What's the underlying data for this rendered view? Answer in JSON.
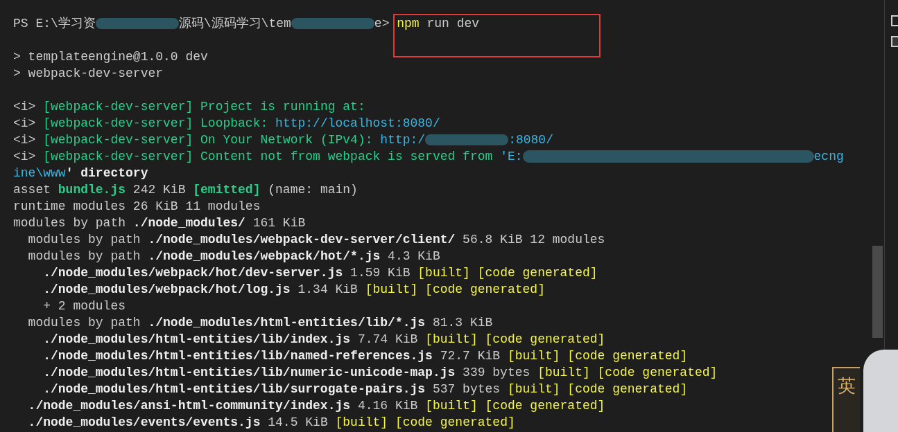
{
  "terminal": {
    "lines": [
      {
        "kind": "text",
        "segments": [
          {
            "kind": "plain",
            "text": "PS E:\\学习资"
          },
          {
            "kind": "redacted"
          },
          {
            "kind": "plain",
            "text": "源码\\源码学习\\tem"
          },
          {
            "kind": "redacted"
          },
          {
            "kind": "plain",
            "text": "e> "
          },
          {
            "kind": "yellow",
            "text": "npm"
          },
          {
            "kind": "plain",
            "text": " run dev"
          }
        ]
      },
      {
        "kind": "blank"
      },
      {
        "kind": "text",
        "segments": [
          {
            "kind": "plain",
            "text": "> templateengine@1.0.0 dev"
          }
        ]
      },
      {
        "kind": "text",
        "segments": [
          {
            "kind": "plain",
            "text": "> webpack-dev-server"
          }
        ]
      },
      {
        "kind": "blank"
      },
      {
        "kind": "text",
        "segments": [
          {
            "kind": "plain",
            "text": "<i> "
          },
          {
            "kind": "green",
            "text": "[webpack-dev-server] Project is running at:"
          }
        ]
      },
      {
        "kind": "text",
        "segments": [
          {
            "kind": "plain",
            "text": "<i> "
          },
          {
            "kind": "green",
            "text": "[webpack-dev-server] Loopback: "
          },
          {
            "kind": "cyan",
            "text": "http://localhost:8080/"
          }
        ]
      },
      {
        "kind": "text",
        "segments": [
          {
            "kind": "plain",
            "text": "<i> "
          },
          {
            "kind": "green",
            "text": "[webpack-dev-server] On Your Network (IPv4): "
          },
          {
            "kind": "cyan",
            "text": "http:/"
          },
          {
            "kind": "redacted"
          },
          {
            "kind": "cyan",
            "text": ":8080/"
          }
        ]
      },
      {
        "kind": "text",
        "segments": [
          {
            "kind": "plain",
            "text": "<i> "
          },
          {
            "kind": "green",
            "text": "[webpack-dev-server] Content not from webpack is served from "
          },
          {
            "kind": "cyan",
            "text": "'E:"
          },
          {
            "kind": "redacted-long"
          },
          {
            "kind": "cyan",
            "text": "ecng"
          }
        ]
      },
      {
        "kind": "text",
        "segments": [
          {
            "kind": "cyan",
            "text": "ine\\www"
          },
          {
            "kind": "bold",
            "text": "' directory"
          }
        ]
      },
      {
        "kind": "text",
        "segments": [
          {
            "kind": "plain",
            "text": "asset "
          },
          {
            "kind": "green-bold",
            "text": "bundle.js"
          },
          {
            "kind": "plain",
            "text": " 242 KiB "
          },
          {
            "kind": "green-bold",
            "text": "[emitted]"
          },
          {
            "kind": "plain",
            "text": " (name: main)"
          }
        ]
      },
      {
        "kind": "text",
        "segments": [
          {
            "kind": "plain",
            "text": "runtime modules 26 KiB 11 modules"
          }
        ]
      },
      {
        "kind": "text",
        "segments": [
          {
            "kind": "plain",
            "text": "modules by path "
          },
          {
            "kind": "bold",
            "text": "./node_modules/"
          },
          {
            "kind": "plain",
            "text": " 161 KiB"
          }
        ]
      },
      {
        "kind": "text",
        "segments": [
          {
            "kind": "plain",
            "text": "  modules by path "
          },
          {
            "kind": "bold",
            "text": "./node_modules/webpack-dev-server/client/"
          },
          {
            "kind": "plain",
            "text": " 56.8 KiB 12 modules"
          }
        ]
      },
      {
        "kind": "text",
        "segments": [
          {
            "kind": "plain",
            "text": "  modules by path "
          },
          {
            "kind": "bold",
            "text": "./node_modules/webpack/hot/*.js"
          },
          {
            "kind": "plain",
            "text": " 4.3 KiB"
          }
        ]
      },
      {
        "kind": "text",
        "segments": [
          {
            "kind": "bold",
            "text": "    ./node_modules/webpack/hot/dev-server.js"
          },
          {
            "kind": "plain",
            "text": " 1.59 KiB "
          },
          {
            "kind": "yellow",
            "text": "[built] [code generated]"
          }
        ]
      },
      {
        "kind": "text",
        "segments": [
          {
            "kind": "bold",
            "text": "    ./node_modules/webpack/hot/log.js"
          },
          {
            "kind": "plain",
            "text": " 1.34 KiB "
          },
          {
            "kind": "yellow",
            "text": "[built] [code generated]"
          }
        ]
      },
      {
        "kind": "text",
        "segments": [
          {
            "kind": "plain",
            "text": "    + 2 modules"
          }
        ]
      },
      {
        "kind": "text",
        "segments": [
          {
            "kind": "plain",
            "text": "  modules by path "
          },
          {
            "kind": "bold",
            "text": "./node_modules/html-entities/lib/*.js"
          },
          {
            "kind": "plain",
            "text": " 81.3 KiB"
          }
        ]
      },
      {
        "kind": "text",
        "segments": [
          {
            "kind": "bold",
            "text": "    ./node_modules/html-entities/lib/index.js"
          },
          {
            "kind": "plain",
            "text": " 7.74 KiB "
          },
          {
            "kind": "yellow",
            "text": "[built] [code generated]"
          }
        ]
      },
      {
        "kind": "text",
        "segments": [
          {
            "kind": "bold",
            "text": "    ./node_modules/html-entities/lib/named-references.js"
          },
          {
            "kind": "plain",
            "text": " 72.7 KiB "
          },
          {
            "kind": "yellow",
            "text": "[built] [code generated]"
          }
        ]
      },
      {
        "kind": "text",
        "segments": [
          {
            "kind": "bold",
            "text": "    ./node_modules/html-entities/lib/numeric-unicode-map.js"
          },
          {
            "kind": "plain",
            "text": " 339 bytes "
          },
          {
            "kind": "yellow",
            "text": "[built] [code generated]"
          }
        ]
      },
      {
        "kind": "text",
        "segments": [
          {
            "kind": "bold",
            "text": "    ./node_modules/html-entities/lib/surrogate-pairs.js"
          },
          {
            "kind": "plain",
            "text": " 537 bytes "
          },
          {
            "kind": "yellow",
            "text": "[built] [code generated]"
          }
        ]
      },
      {
        "kind": "text",
        "segments": [
          {
            "kind": "bold",
            "text": "  ./node_modules/ansi-html-community/index.js"
          },
          {
            "kind": "plain",
            "text": " 4.16 KiB "
          },
          {
            "kind": "yellow",
            "text": "[built] [code generated]"
          }
        ]
      },
      {
        "kind": "text",
        "segments": [
          {
            "kind": "bold",
            "text": "  ./node_modules/events/events.js"
          },
          {
            "kind": "plain",
            "text": " 14.5 KiB "
          },
          {
            "kind": "yellow",
            "text": "[built] [code generated]"
          }
        ]
      }
    ]
  },
  "ime_indicator": {
    "label": "英"
  }
}
